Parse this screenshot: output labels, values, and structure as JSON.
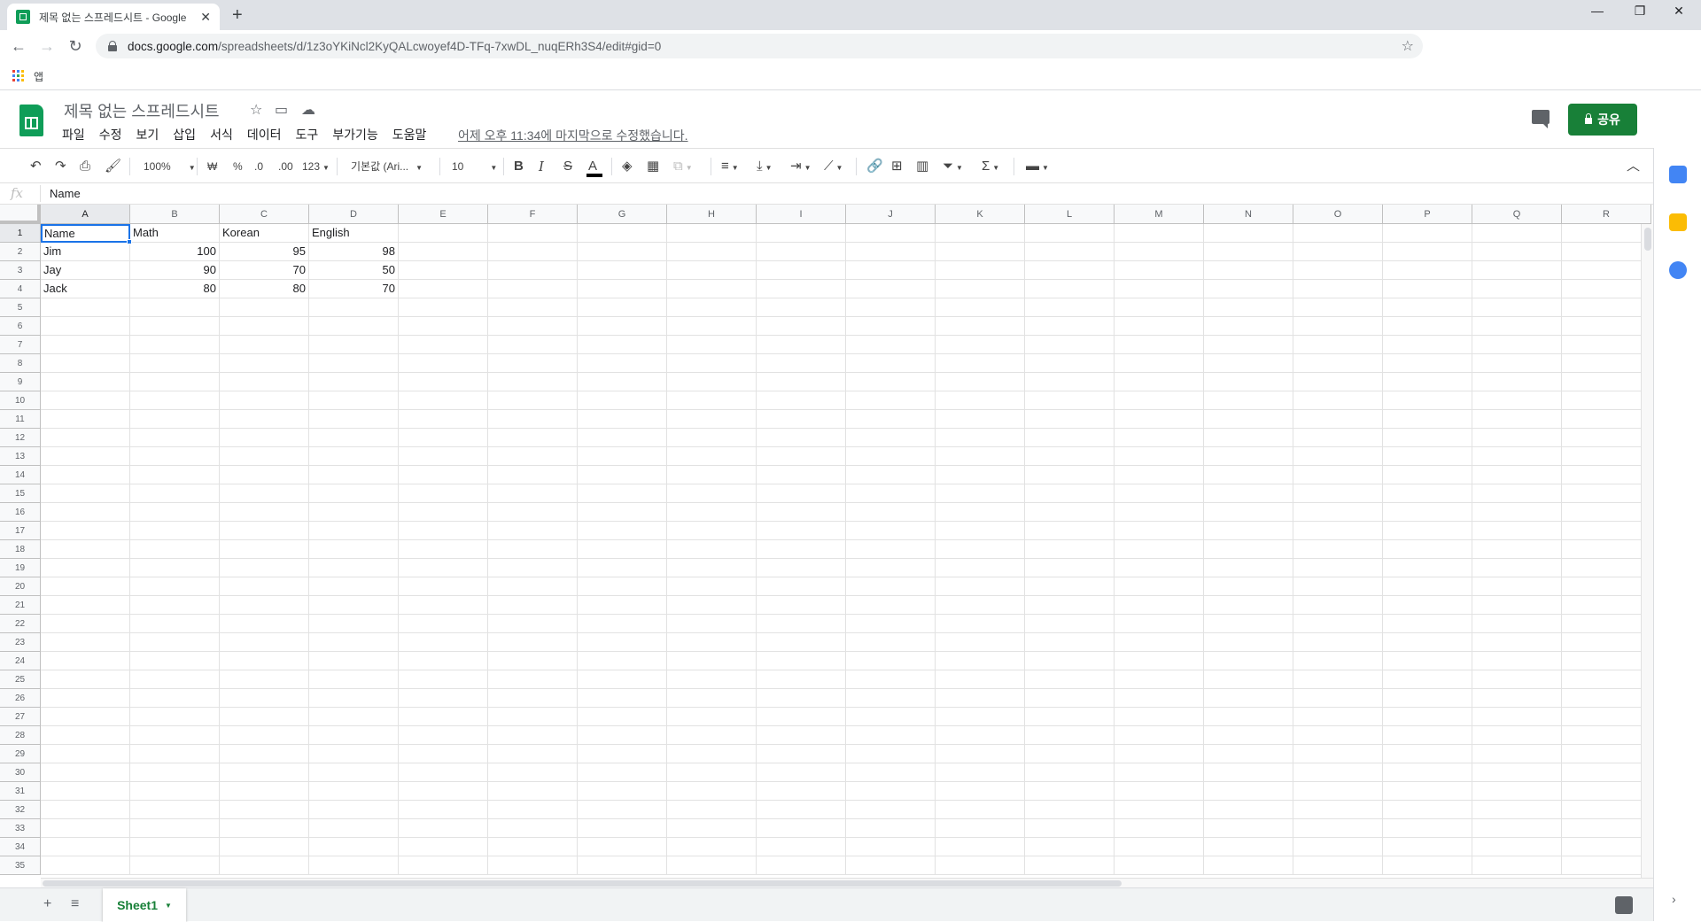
{
  "browser": {
    "tab_title": "제목 없는 스프레드시트 - Google",
    "url_host": "docs.google.com",
    "url_path": "/spreadsheets/d/1z3oYKiNcl2KyQALcwoyef4D-TFq-7xwDL_nuqERh3S4/edit#gid=0",
    "bookmark_label": "앱"
  },
  "doc": {
    "title": "제목 없는 스프레드시트",
    "menus": [
      "파일",
      "수정",
      "보기",
      "삽입",
      "서식",
      "데이터",
      "도구",
      "부가기능",
      "도움말"
    ],
    "last_edit": "어제 오후 11:34에 마지막으로 수정했습니다.",
    "share_label": "공유"
  },
  "toolbar": {
    "zoom": "100%",
    "currency": "₩",
    "percent": "%",
    "dec_decrease": ".0",
    "dec_increase": ".00",
    "more_formats": "123",
    "font": "기본값 (Ari...",
    "font_size": "10",
    "bold": "B",
    "italic": "I",
    "strike": "S",
    "text_color": "A"
  },
  "formula_bar": {
    "fx": "fx",
    "value": "Name"
  },
  "grid": {
    "columns": [
      "A",
      "B",
      "C",
      "D",
      "E",
      "F",
      "G",
      "H",
      "I",
      "J",
      "K",
      "L",
      "M",
      "N",
      "O",
      "P",
      "Q",
      "R"
    ],
    "row_count": 35,
    "active_cell": "A1",
    "cells": [
      [
        "Name",
        "Math",
        "Korean",
        "English"
      ],
      [
        "Jim",
        "100",
        "95",
        "98"
      ],
      [
        "Jay",
        "90",
        "70",
        "50"
      ],
      [
        "Jack",
        "80",
        "80",
        "70"
      ]
    ],
    "numeric_columns": [
      1,
      2,
      3
    ],
    "numeric_from_row": 1
  },
  "sheets": {
    "active_sheet": "Sheet1"
  },
  "colors": {
    "sheets_green": "#0f9d58",
    "share_green": "#188038",
    "selection_blue": "#1a73e8"
  }
}
